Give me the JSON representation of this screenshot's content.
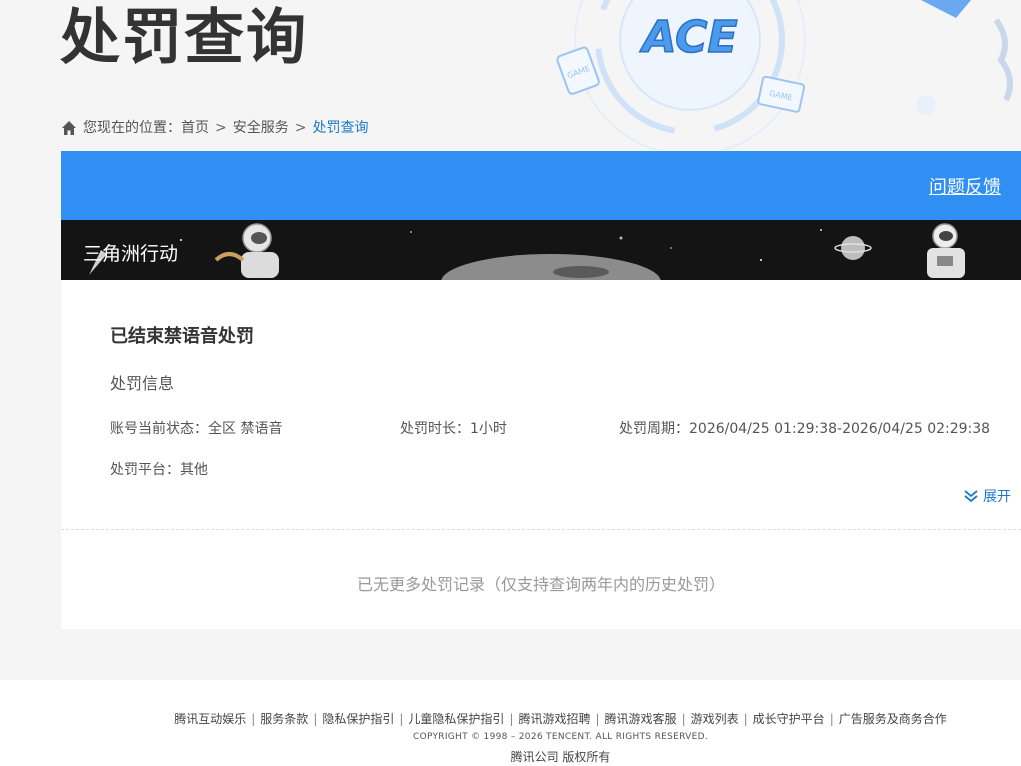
{
  "header": {
    "title": "处罚查询",
    "logo_text": "ACE",
    "tag1": "GAME",
    "tag2": "GAME"
  },
  "breadcrumb": {
    "prefix": "您现在的位置：",
    "items": [
      "首页",
      "安全服务"
    ],
    "current": "处罚查询",
    "separator": ">"
  },
  "card": {
    "feedback_label": "问题反馈",
    "game_name": "三角洲行动"
  },
  "record": {
    "title": "已结束禁语音处罚",
    "subtitle": "处罚信息",
    "status_label": "账号当前状态：",
    "status_value": "全区 禁语音",
    "duration_label": "处罚时长：",
    "duration_value": "1小时",
    "period_label": "处罚周期：",
    "period_value": "2026/04/25 01:29:38-2026/04/25 02:29:38",
    "platform_label": "处罚平台：",
    "platform_value": "其他",
    "expand_label": "展开"
  },
  "no_more": "已无更多处罚记录（仅支持查询两年内的历史处罚）",
  "footer": {
    "links": [
      "腾讯互动娱乐",
      "服务条款",
      "隐私保护指引",
      "儿童隐私保护指引",
      "腾讯游戏招聘",
      "腾讯游戏客服",
      "游戏列表",
      "成长守护平台",
      "广告服务及商务合作"
    ],
    "copyright": "COPYRIGHT © 1998 – 2026 TENCENT. ALL RIGHTS RESERVED.",
    "rights": "腾讯公司 版权所有"
  },
  "colors": {
    "accent": "#2f8ff2",
    "link": "#1e78c8",
    "banner_bg": "#141414"
  }
}
